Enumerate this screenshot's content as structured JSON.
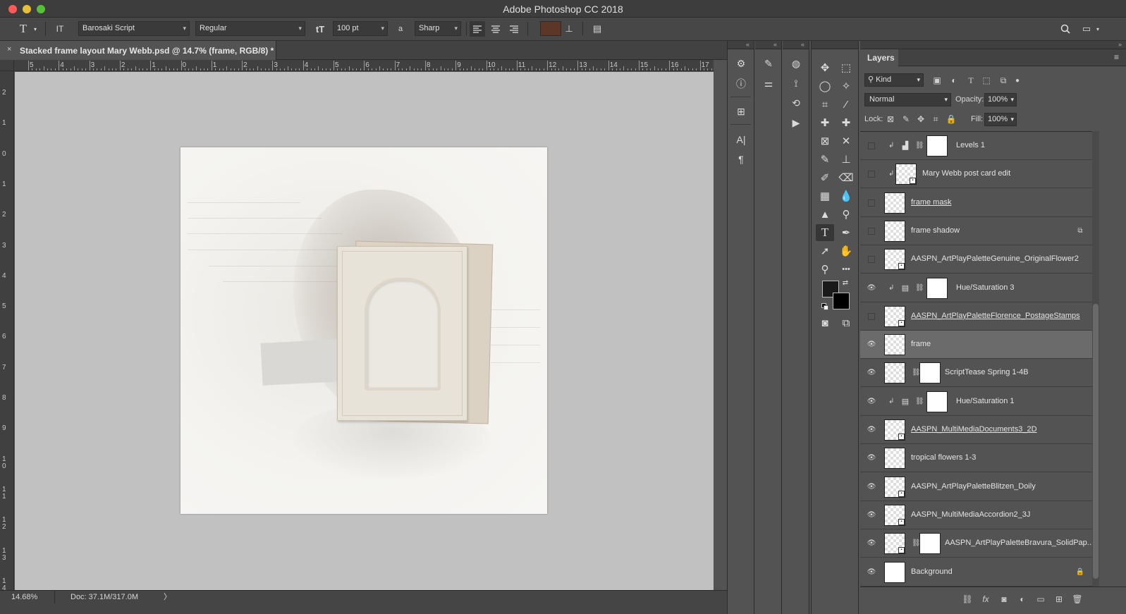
{
  "window": {
    "title": "Adobe Photoshop CC 2018"
  },
  "options_bar": {
    "tool_icon": "T",
    "orientation_icon": "IT",
    "font_family": "Barosaki Script",
    "font_style": "Regular",
    "size_icon": "tT",
    "font_size": "100 pt",
    "aa_icon": "a",
    "antialias": "Sharp",
    "text_color": "#5c3626"
  },
  "document": {
    "tab_label": "Stacked frame layout Mary Webb.psd @ 14.7% (frame, RGB/8) *",
    "close_glyph": "×"
  },
  "ruler": {
    "top_labels": [
      "5",
      "4",
      "3",
      "2",
      "1",
      "0",
      "1",
      "2",
      "3",
      "4",
      "5",
      "6",
      "7",
      "8",
      "9",
      "10",
      "11",
      "12",
      "13",
      "14",
      "15",
      "16",
      "17"
    ],
    "left_labels": [
      "2",
      "1",
      "0",
      "1",
      "2",
      "3",
      "4",
      "5",
      "6",
      "7",
      "8",
      "9",
      "10",
      "11",
      "12",
      "13",
      "14"
    ]
  },
  "status": {
    "zoom": "14.68%",
    "doc": "Doc: 37.1M/317.0M",
    "arrow": "〉"
  },
  "dock": {
    "collapse_glyph": "«"
  },
  "tools": {
    "text_tool": "T",
    "more": "•••"
  },
  "layers_panel": {
    "title": "Layers",
    "menu_glyph": "≡",
    "kind_filter": "Kind",
    "blend_mode": "Normal",
    "opacity_label": "Opacity:",
    "opacity_value": "100%",
    "lock_label": "Lock:",
    "fill_label": "Fill:",
    "fill_value": "100%",
    "layers": [
      {
        "name": "Levels 1",
        "visible": false,
        "type": "adjustment",
        "adj_icon": "levels-icon",
        "clipped": true,
        "selected": false
      },
      {
        "name": "Mary Webb post card edit",
        "visible": false,
        "type": "smart",
        "clipped": true,
        "selected": false
      },
      {
        "name": "frame mask",
        "visible": false,
        "type": "pixel",
        "underline": true,
        "selected": false
      },
      {
        "name": "frame shadow",
        "visible": false,
        "type": "pixel",
        "badge": "link-badge-icon",
        "selected": false
      },
      {
        "name": "AASPN_ArtPlayPaletteGenuine_OriginalFlower2",
        "visible": false,
        "type": "smart",
        "selected": false
      },
      {
        "name": "Hue/Saturation 3",
        "visible": true,
        "type": "adjustment",
        "adj_icon": "hue-saturation-icon",
        "clipped": true,
        "selected": false
      },
      {
        "name": "AASPN_ArtPlayPaletteFlorence_PostageStamps",
        "visible": false,
        "type": "smart",
        "underline": true,
        "selected": false
      },
      {
        "name": "frame",
        "visible": true,
        "type": "pixel",
        "selected": true
      },
      {
        "name": "ScriptTease Spring 1-4B",
        "visible": true,
        "type": "masked",
        "selected": false
      },
      {
        "name": "Hue/Saturation 1",
        "visible": true,
        "type": "adjustment",
        "adj_icon": "hue-saturation-icon",
        "clipped": true,
        "selected": false
      },
      {
        "name": "AASPN_MultiMediaDocuments3_2D",
        "visible": true,
        "type": "smart",
        "underline": true,
        "selected": false
      },
      {
        "name": "tropical flowers 1-3",
        "visible": true,
        "type": "pixel",
        "selected": false
      },
      {
        "name": "AASPN_ArtPlayPaletteBlitzen_Doily",
        "visible": true,
        "type": "smart",
        "selected": false
      },
      {
        "name": "AASPN_MultiMediaAccordion2_3J",
        "visible": true,
        "type": "smart",
        "selected": false
      },
      {
        "name": "AASPN_ArtPlayPaletteBravura_SolidPap...",
        "visible": true,
        "type": "smart-masked",
        "selected": false
      },
      {
        "name": "Background",
        "visible": true,
        "type": "background",
        "badge": "lock-badge-icon",
        "selected": false
      }
    ]
  }
}
